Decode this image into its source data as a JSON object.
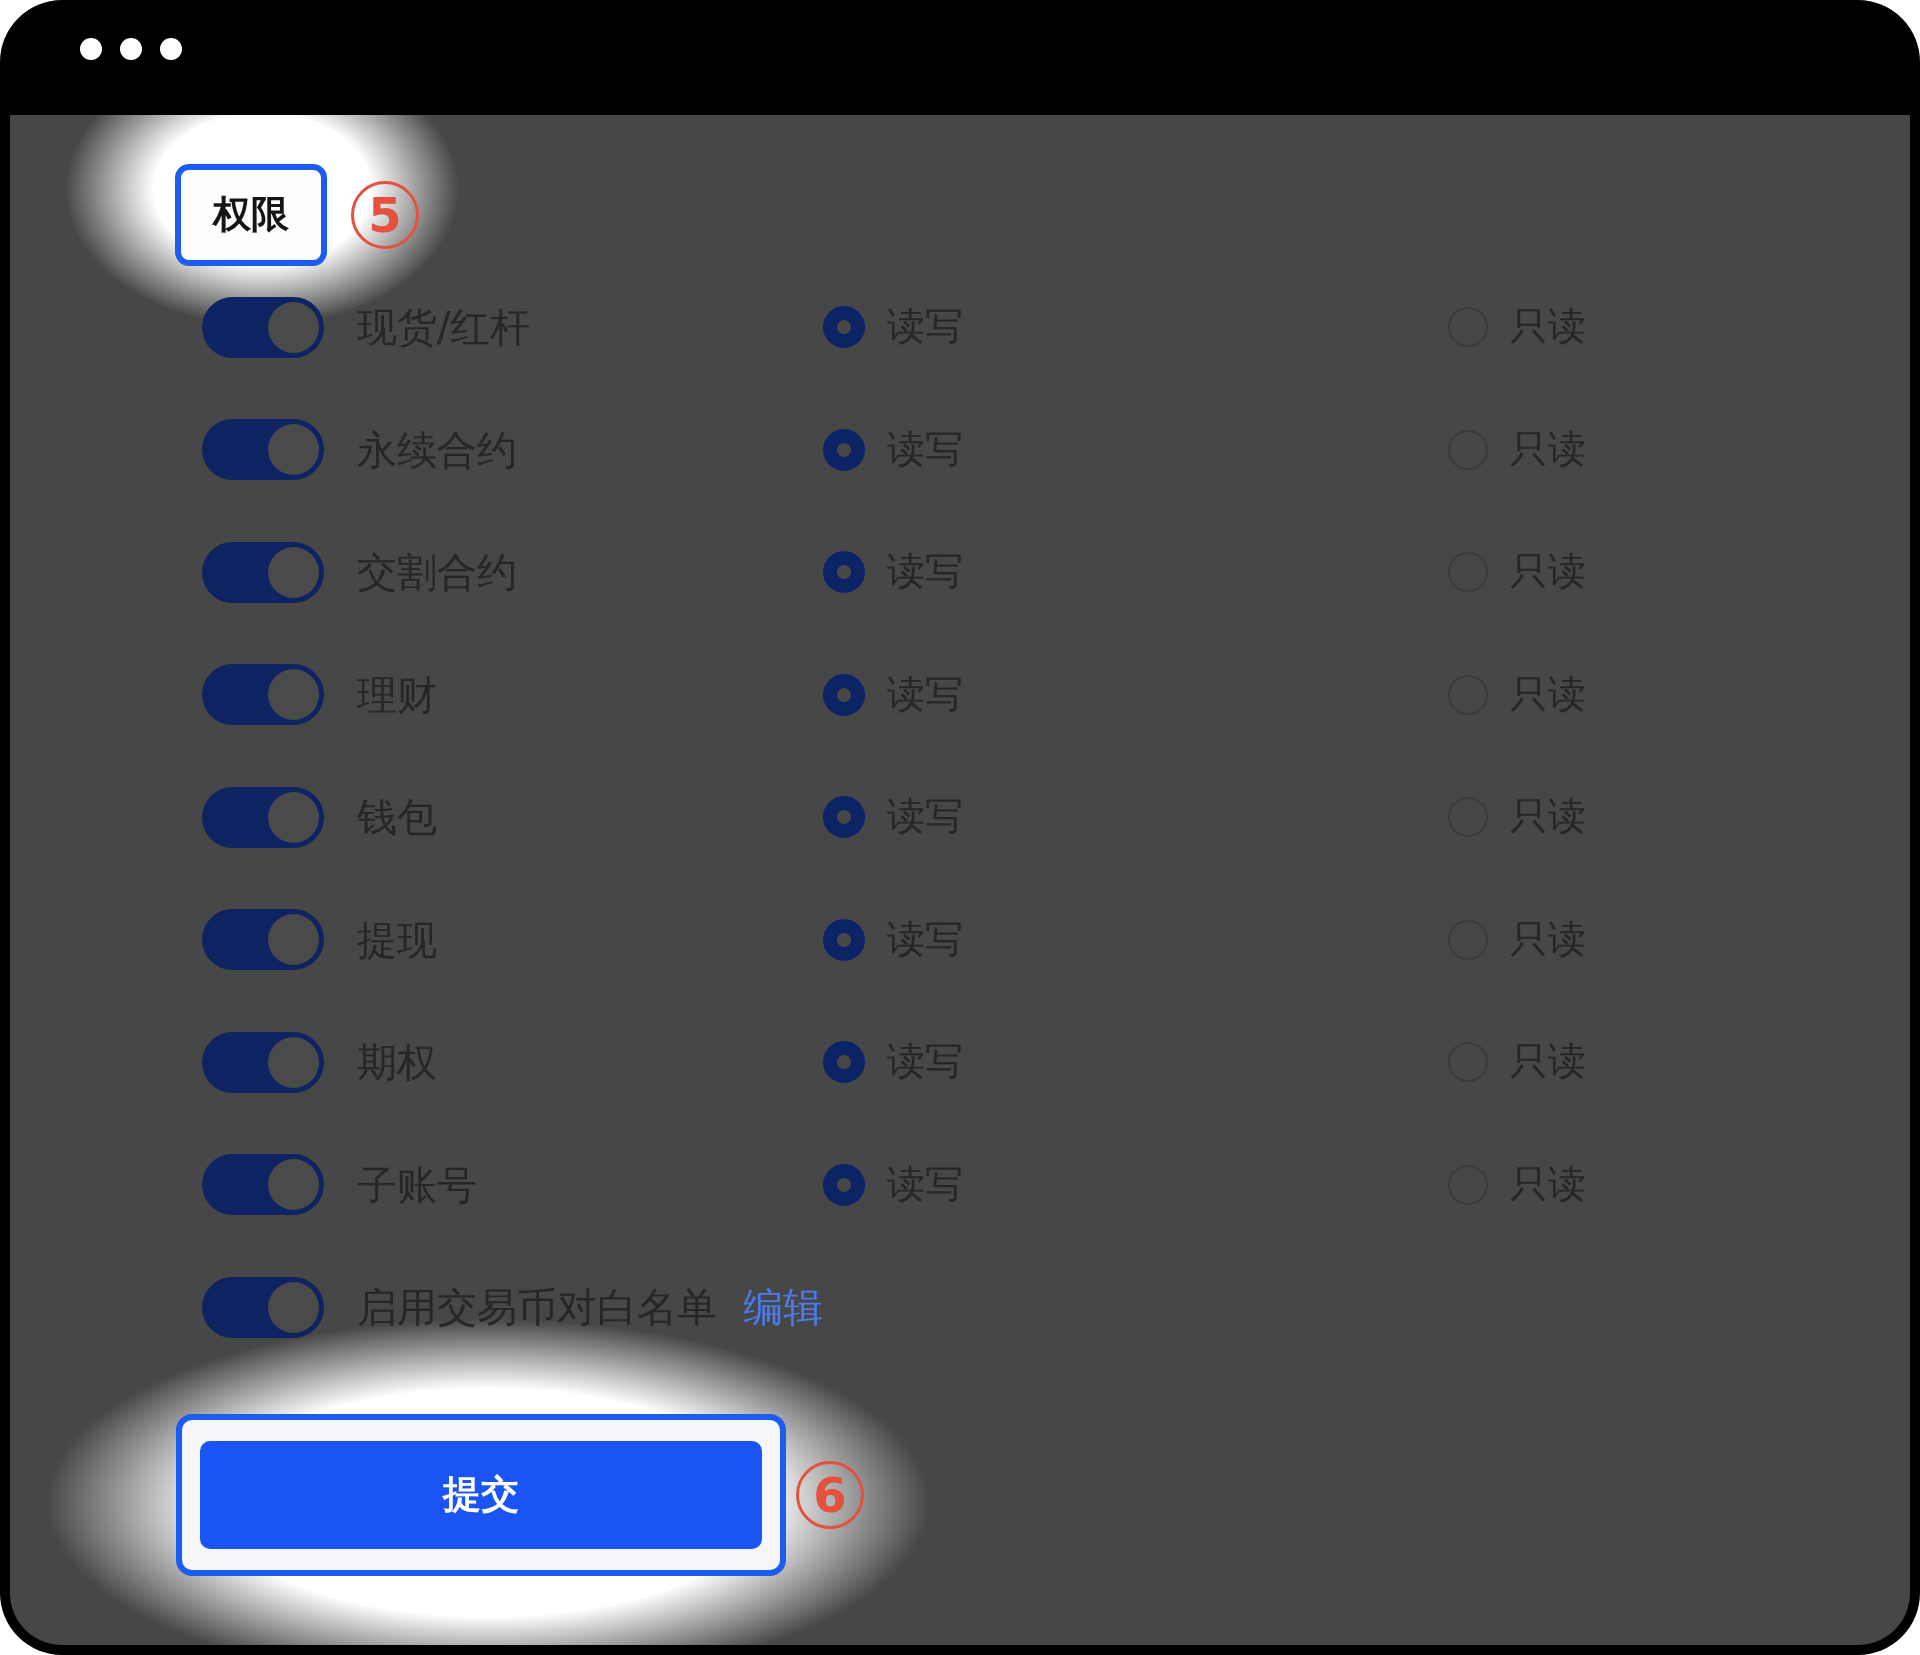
{
  "section": {
    "title": "权限",
    "step": "5"
  },
  "permissions": [
    {
      "name": "现货/红杆",
      "enabled": true,
      "options": [
        {
          "label": "读写",
          "selected": true
        },
        {
          "label": "只读",
          "selected": false
        }
      ]
    },
    {
      "name": "永续合约",
      "enabled": true,
      "options": [
        {
          "label": "读写",
          "selected": true
        },
        {
          "label": "只读",
          "selected": false
        }
      ]
    },
    {
      "name": "交割合约",
      "enabled": true,
      "options": [
        {
          "label": "读写",
          "selected": true
        },
        {
          "label": "只读",
          "selected": false
        }
      ]
    },
    {
      "name": "理财",
      "enabled": true,
      "options": [
        {
          "label": "读写",
          "selected": true
        },
        {
          "label": "只读",
          "selected": false
        }
      ]
    },
    {
      "name": "钱包",
      "enabled": true,
      "options": [
        {
          "label": "读写",
          "selected": true
        },
        {
          "label": "只读",
          "selected": false
        }
      ]
    },
    {
      "name": "提现",
      "enabled": true,
      "options": [
        {
          "label": "读写",
          "selected": true
        },
        {
          "label": "只读",
          "selected": false
        }
      ]
    },
    {
      "name": "期权",
      "enabled": true,
      "options": [
        {
          "label": "读写",
          "selected": true
        },
        {
          "label": "只读",
          "selected": false
        }
      ]
    },
    {
      "name": "子账号",
      "enabled": true,
      "options": [
        {
          "label": "读写",
          "selected": true
        },
        {
          "label": "只读",
          "selected": false
        }
      ]
    }
  ],
  "whitelist": {
    "label": "启用交易币对白名单",
    "enabled": true,
    "link": "编辑"
  },
  "submit": {
    "label": "提交",
    "step": "6"
  }
}
